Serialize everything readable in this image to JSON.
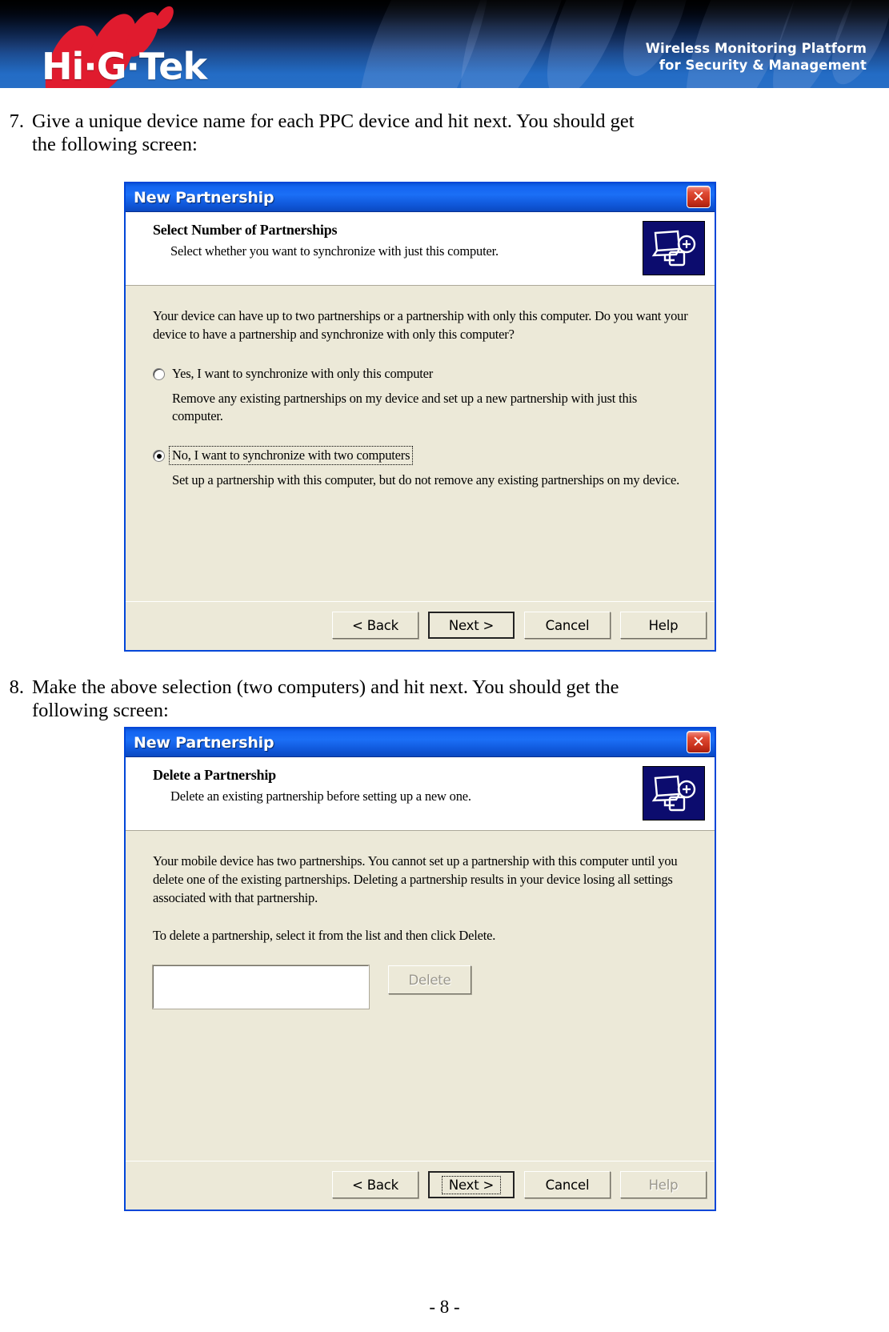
{
  "header": {
    "logo_text": "Hi·G·Tek",
    "tagline_line1": "Wireless Monitoring Platform",
    "tagline_line2": "for Security & Management",
    "accent_red": "#e01b2e",
    "accent_blue": "#1160c0"
  },
  "steps": [
    {
      "number": "7.",
      "text": "Give a unique device name for each PPC device and hit next. You should get the following screen:"
    },
    {
      "number": "8.",
      "text": "Make the above selection (two computers) and hit next. You should get the following screen:"
    }
  ],
  "dialog1": {
    "title": "New Partnership",
    "close_label": "✕",
    "heading": "Select Number of Partnerships",
    "subheading": "Select whether you want to synchronize with just this computer.",
    "body_paragraph": "Your device can have up to two partnerships or a partnership with only this computer. Do you want your device to have a partnership and synchronize with only this computer?",
    "option_yes_label": "Yes, I want to synchronize with only this computer",
    "option_yes_desc": "Remove any existing partnerships on my device and set up a new partnership with just this computer.",
    "option_no_label": "No, I want to synchronize with two computers",
    "option_no_desc": "Set up a partnership with this computer, but do not remove any existing partnerships on my device.",
    "selected_option": "no",
    "buttons": {
      "back": "< Back",
      "next": "Next >",
      "cancel": "Cancel",
      "help": "Help"
    }
  },
  "dialog2": {
    "title": "New Partnership",
    "close_label": "✕",
    "heading": "Delete a Partnership",
    "subheading": "Delete an existing partnership before setting up a new one.",
    "body_paragraph": "Your mobile device has two partnerships. You cannot set up a partnership with this computer until you delete one of the existing partnerships. Deleting a partnership results in your device losing all settings associated with that partnership.",
    "instruction": "To delete a partnership, select it from the list and then click Delete.",
    "list_value": "",
    "delete_button": "Delete",
    "buttons": {
      "back": "< Back",
      "next": "Next >",
      "cancel": "Cancel",
      "help": "Help"
    }
  },
  "footer": {
    "page_number": "- 8 -"
  }
}
